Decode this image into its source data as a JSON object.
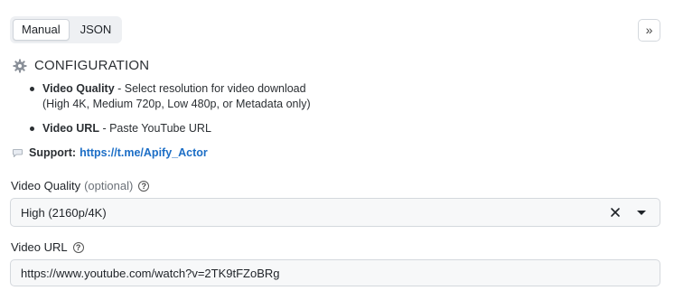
{
  "tabs": [
    {
      "label": "Manual",
      "active": true
    },
    {
      "label": "JSON",
      "active": false
    }
  ],
  "collapse_button": "»",
  "config": {
    "icon": "gear-icon",
    "title": "CONFIGURATION",
    "items": [
      {
        "name": "Video Quality",
        "desc_line1": " - Select resolution for video download",
        "desc_line2": "(High 4K, Medium 720p, Low 480p, or Metadata only)"
      },
      {
        "name": "Video URL",
        "desc_line1": " - Paste YouTube URL"
      }
    ]
  },
  "support": {
    "icon": "speech-bubble-icon",
    "label": "Support:",
    "link": "https://t.me/Apify_Actor"
  },
  "fields": {
    "video_quality": {
      "label": "Video Quality",
      "optional": "(optional)",
      "value": "High (2160p/4K)"
    },
    "video_url": {
      "label": "Video URL",
      "value": "https://www.youtube.com/watch?v=2TK9tFZoBRg"
    }
  },
  "colors": {
    "link": "#1c6ec6",
    "field_bg": "#f7f8f9",
    "border": "#d4d8dd"
  }
}
